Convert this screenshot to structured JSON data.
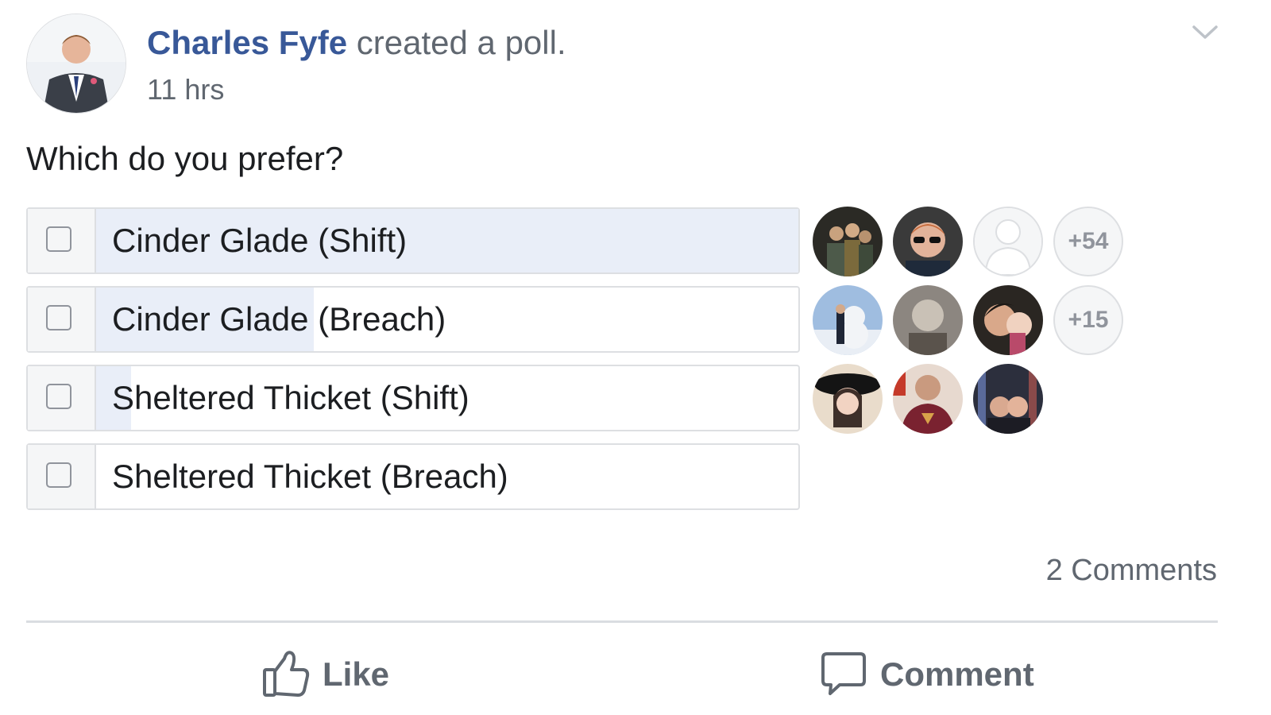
{
  "post": {
    "author": "Charles Fyfe",
    "action": "created a poll.",
    "time": "11 hrs",
    "question": "Which do you prefer?"
  },
  "poll": {
    "options": [
      {
        "label": "Cinder Glade (Shift)",
        "vote_share": 1.0,
        "more_voters": "+54"
      },
      {
        "label": "Cinder Glade (Breach)",
        "vote_share": 0.31,
        "more_voters": "+15"
      },
      {
        "label": "Sheltered Thicket (Shift)",
        "vote_share": 0.05,
        "more_voters": ""
      },
      {
        "label": "Sheltered Thicket (Breach)",
        "vote_share": 0.0,
        "more_voters": ""
      }
    ]
  },
  "footer": {
    "comments": "2 Comments",
    "like_label": "Like",
    "comment_label": "Comment"
  },
  "colors": {
    "author": "#385898",
    "vote_fill": "#e9eef8",
    "secondary_text": "#606770"
  }
}
